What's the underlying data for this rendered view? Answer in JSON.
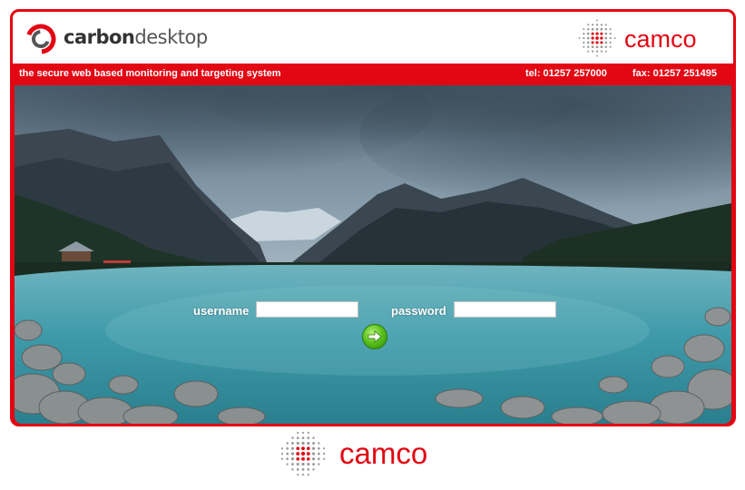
{
  "header": {
    "brand_bold": "carbon",
    "brand_light": "desktop",
    "partner_logo_text": "camco"
  },
  "tagline_bar": {
    "tagline": "the secure web based monitoring and targeting system",
    "tel": "tel: 01257 257000",
    "fax": "fax: 01257 251495"
  },
  "login": {
    "username_label": "username",
    "username_value": "",
    "password_label": "password",
    "password_value": "",
    "submit_icon": "arrow-right-icon"
  },
  "footer": {
    "logo_text": "camco"
  },
  "colors": {
    "brand_red": "#e30613",
    "go_green": "#4cb81a"
  }
}
